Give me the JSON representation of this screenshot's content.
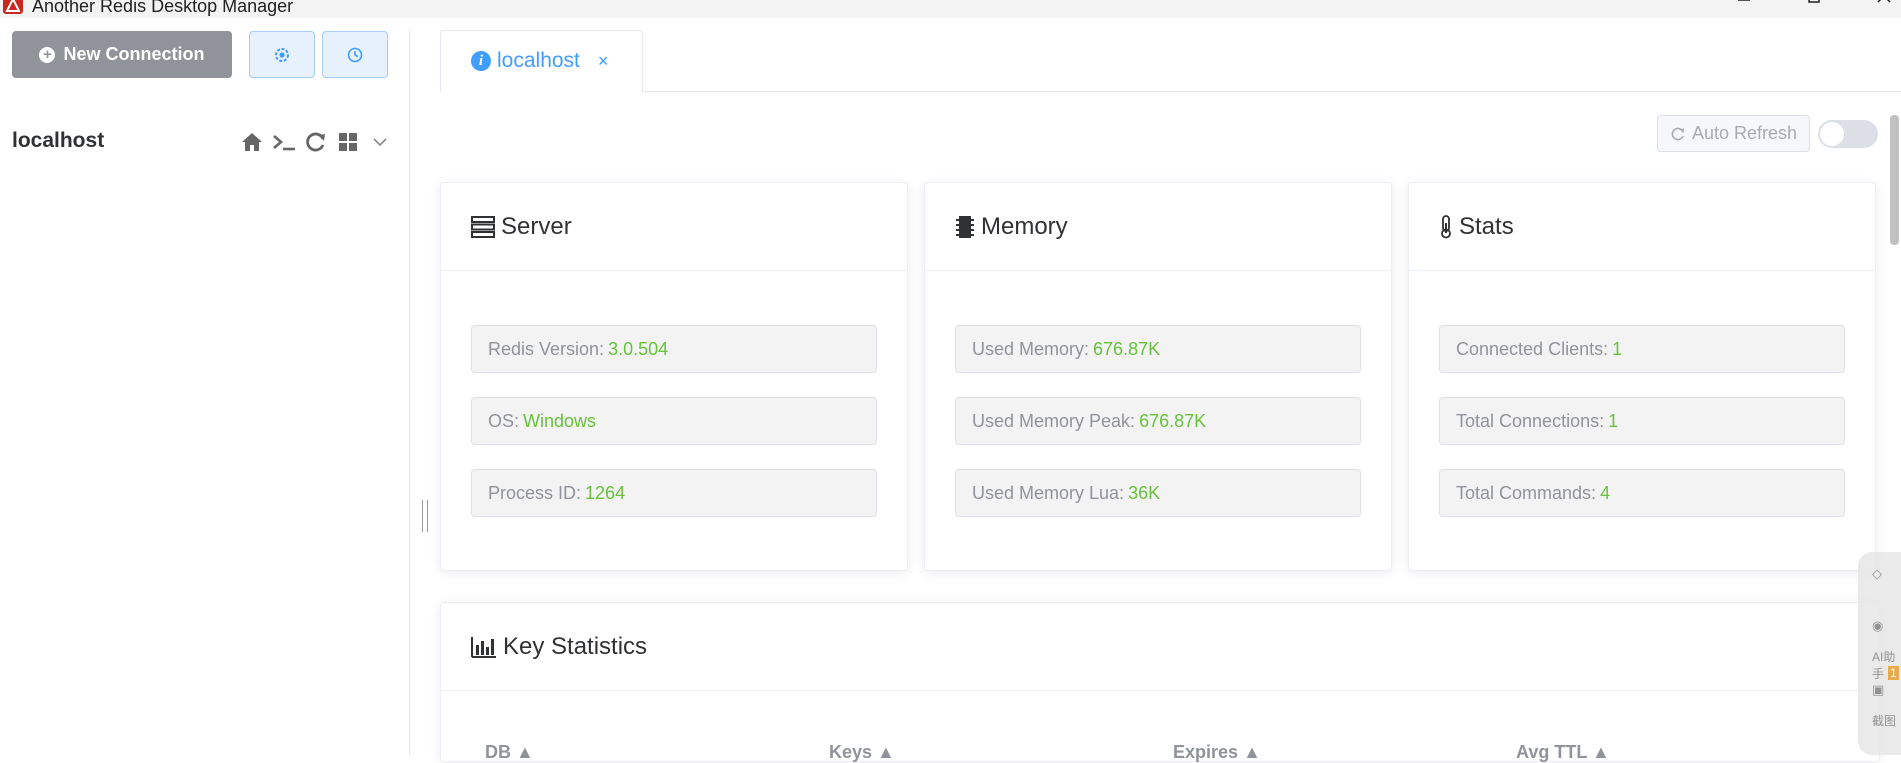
{
  "window": {
    "title": "Another Redis Desktop Manager"
  },
  "sidebar": {
    "new_connection_label": "New Connection",
    "connection": {
      "name": "localhost"
    }
  },
  "tabs": [
    {
      "label": "localhost",
      "close": "×"
    }
  ],
  "toolbar": {
    "auto_refresh_label": "Auto Refresh",
    "auto_refresh_on": false
  },
  "cards": {
    "server": {
      "title": "Server",
      "items": [
        {
          "label": "Redis Version:",
          "value": "3.0.504"
        },
        {
          "label": "OS:",
          "value": "Windows"
        },
        {
          "label": "Process ID:",
          "value": "1264"
        }
      ]
    },
    "memory": {
      "title": "Memory",
      "items": [
        {
          "label": "Used Memory:",
          "value": "676.87K"
        },
        {
          "label": "Used Memory Peak:",
          "value": "676.87K"
        },
        {
          "label": "Used Memory Lua:",
          "value": "36K"
        }
      ]
    },
    "stats": {
      "title": "Stats",
      "items": [
        {
          "label": "Connected Clients:",
          "value": "1"
        },
        {
          "label": "Total Connections:",
          "value": "1"
        },
        {
          "label": "Total Commands:",
          "value": "4"
        }
      ]
    }
  },
  "key_statistics": {
    "title": "Key Statistics",
    "columns": [
      "DB",
      "Keys",
      "Expires",
      "Avg TTL"
    ]
  },
  "float_widget": {
    "ai_label": "AI助手",
    "badge": "1",
    "shot_label": "截图"
  },
  "colors": {
    "accent": "#409eff",
    "value": "#67c23a",
    "button_gray": "#909399"
  }
}
